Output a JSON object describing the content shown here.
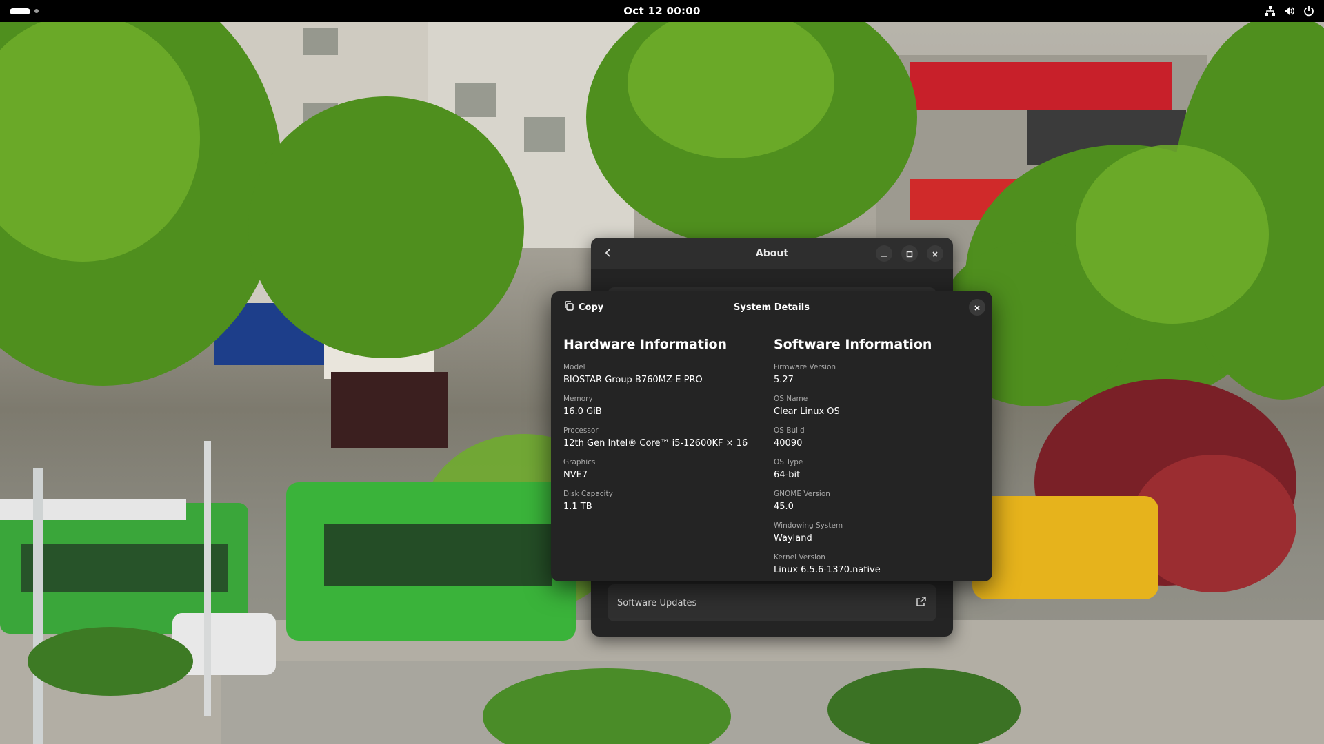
{
  "topbar": {
    "clock": "Oct 12  00:00",
    "tray_icons": [
      "network-icon",
      "volume-icon",
      "power-icon"
    ]
  },
  "about_window": {
    "title": "About",
    "software_updates_label": "Software Updates"
  },
  "system_details": {
    "title": "System Details",
    "copy_label": "Copy",
    "hardware": {
      "heading": "Hardware Information",
      "fields": [
        {
          "label": "Model",
          "value": "BIOSTAR Group B760MZ-E PRO"
        },
        {
          "label": "Memory",
          "value": "16.0 GiB"
        },
        {
          "label": "Processor",
          "value": "12th Gen Intel® Core™ i5-12600KF × 16"
        },
        {
          "label": "Graphics",
          "value": "NVE7"
        },
        {
          "label": "Disk Capacity",
          "value": "1.1 TB"
        }
      ]
    },
    "software": {
      "heading": "Software Information",
      "fields": [
        {
          "label": "Firmware Version",
          "value": "5.27"
        },
        {
          "label": "OS Name",
          "value": "Clear Linux OS"
        },
        {
          "label": "OS Build",
          "value": "40090"
        },
        {
          "label": "OS Type",
          "value": "64-bit"
        },
        {
          "label": "GNOME Version",
          "value": "45.0"
        },
        {
          "label": "Windowing System",
          "value": "Wayland"
        },
        {
          "label": "Kernel Version",
          "value": "Linux 6.5.6-1370.native"
        }
      ]
    }
  },
  "colors": {
    "topbar_bg": "#000000",
    "dialog_bg": "#242424",
    "card_bg": "#303030",
    "label_color": "#a8a8a8"
  }
}
